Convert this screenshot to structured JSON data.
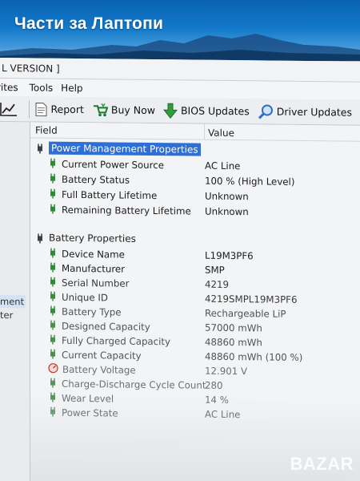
{
  "watermark_top": "Части за Лаптопи",
  "watermark_bottom": "BAZAR",
  "window": {
    "title": "L VERSION ]"
  },
  "menu": [
    "rites",
    "Tools",
    "Help"
  ],
  "toolbar": {
    "report": "Report",
    "buy_now": "Buy Now",
    "bios_updates": "BIOS Updates",
    "driver_updates": "Driver Updates"
  },
  "left_pane": {
    "items": [
      "ment",
      "ter"
    ]
  },
  "columns": {
    "field": "Field",
    "value": "Value"
  },
  "power_management": {
    "title": "Power Management Properties",
    "rows": [
      {
        "field": "Current Power Source",
        "value": "AC Line"
      },
      {
        "field": "Battery Status",
        "value": "100 % (High Level)"
      },
      {
        "field": "Full Battery Lifetime",
        "value": "Unknown"
      },
      {
        "field": "Remaining Battery Lifetime",
        "value": "Unknown"
      }
    ]
  },
  "battery": {
    "title": "Battery Properties",
    "rows": [
      {
        "field": "Device Name",
        "value": "L19M3PF6"
      },
      {
        "field": "Manufacturer",
        "value": "SMP"
      },
      {
        "field": "Serial Number",
        "value": "4219"
      },
      {
        "field": "Unique ID",
        "value": "4219SMPL19M3PF6"
      },
      {
        "field": "Battery Type",
        "value": "Rechargeable LiP"
      },
      {
        "field": "Designed Capacity",
        "value": "57000 mWh"
      },
      {
        "field": "Fully Charged Capacity",
        "value": "48860 mWh"
      },
      {
        "field": "Current Capacity",
        "value": "48860 mWh  (100 %)"
      },
      {
        "field": "Battery Voltage",
        "value": "12.901 V"
      },
      {
        "field": "Charge-Discharge Cycle Count",
        "value": "280"
      },
      {
        "field": "Wear Level",
        "value": "14 %"
      },
      {
        "field": "Power State",
        "value": "AC Line"
      }
    ]
  }
}
